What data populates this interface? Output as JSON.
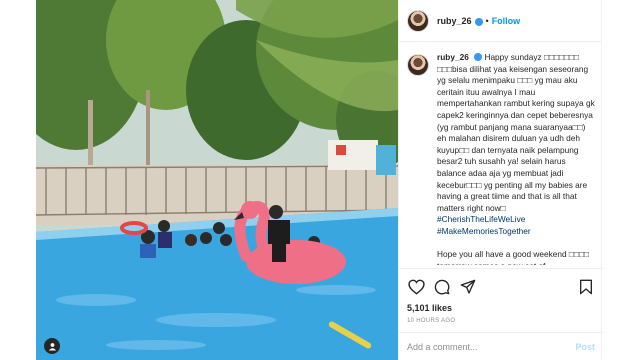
{
  "header": {
    "username": "ruby_26",
    "dot": "•",
    "follow_label": "Follow"
  },
  "caption": {
    "username": "ruby_26",
    "text_1": "Happy sundayz □□□□□□□ □□□bisa dilihat yaa keisengan seseorang yg selalu menimpaku □□□ yg mau aku ceritain ituu awalnya I mau mempertahankan rambut kering supaya gk capek2 keringinnya dan cepet beberesnya (yg rambut panjang mana suaranyaa□□) eh malahan disirem duluan ya udh deh kuyup□□ dan ternyata naik pelampung besar2 tuh susahh ya! selain harus balance adaa aja yg membuat jadi kecebur□□□ yg penting all my babies are having a great tiime and that is all that matters right now□ ",
    "hashtag_1": "#CherishTheLifeWeLive",
    "hashtag_2": "#MakeMemoriesTogether",
    "text_2": "Hope you all have a good weekend □□□□ tomorrow comes a new set of"
  },
  "actions": {
    "likes": "5,101 likes",
    "time_ago": "10 HOURS AGO"
  },
  "comment": {
    "placeholder": "Add a comment...",
    "post_label": "Post"
  },
  "icons": {
    "user_tag": "user-tag-icon",
    "like": "heart-icon",
    "comment": "comment-icon",
    "share": "share-icon",
    "save": "bookmark-icon",
    "verified": "verified-badge-icon"
  }
}
